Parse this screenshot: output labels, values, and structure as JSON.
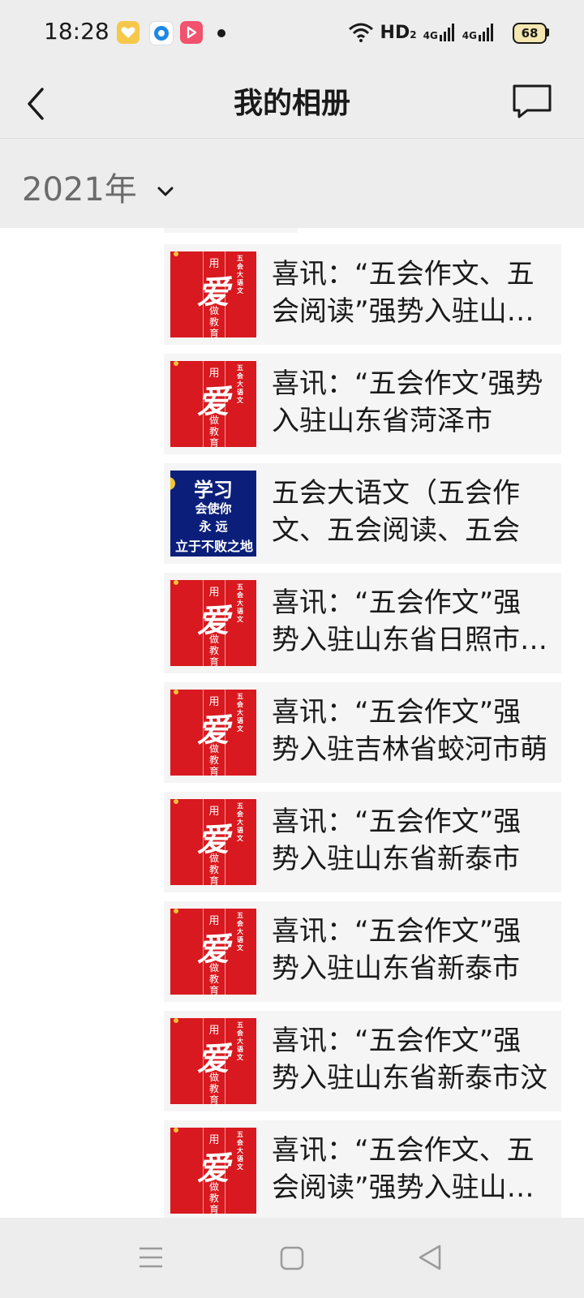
{
  "status_bar": {
    "time": "18:28",
    "network_label": "HD",
    "network_sub": "2",
    "signal1_label": "4G",
    "signal2_label": "4G",
    "battery": "68"
  },
  "header": {
    "title": "我的相册",
    "back_icon": "chevron-left-icon",
    "message_icon": "message-bubble-icon"
  },
  "filter": {
    "year": "2021年",
    "chevron_icon": "chevron-down-icon"
  },
  "thumb_text": {
    "red_top": "用",
    "red_main": "爱",
    "red_bottom": "做教育",
    "red_side": "五会大语文",
    "blue_line1": "学习",
    "blue_line2": "会使你",
    "blue_line3": "永 远",
    "blue_line4": "立于不败之地"
  },
  "items": [
    {
      "title": "喜讯：“五会作文、五会阅读”强势入驻山东省",
      "thumb": "red"
    },
    {
      "title": "喜讯：“五会作文’强势入驻山东省菏泽市",
      "thumb": "red"
    },
    {
      "title": "五会大语文（五会作文、五会阅读、五会",
      "thumb": "blue"
    },
    {
      "title": "喜讯：“五会作文”强势入驻山东省日照市莒县",
      "thumb": "red"
    },
    {
      "title": "喜讯：“五会作文”强势入驻吉林省蛟河市萌",
      "thumb": "red"
    },
    {
      "title": "喜讯：“五会作文”强势入驻山东省新泰市",
      "thumb": "red"
    },
    {
      "title": "喜讯：“五会作文”强势入驻山东省新泰市",
      "thumb": "red"
    },
    {
      "title": "喜讯：“五会作文”强势入驻山东省新泰市汶",
      "thumb": "red"
    },
    {
      "title": "喜讯：“五会作文、五会阅读”强势入驻山东省",
      "thumb": "red"
    }
  ],
  "nav": {
    "menu_icon": "menu-icon",
    "home_icon": "square-home-icon",
    "back_icon": "triangle-back-icon"
  }
}
